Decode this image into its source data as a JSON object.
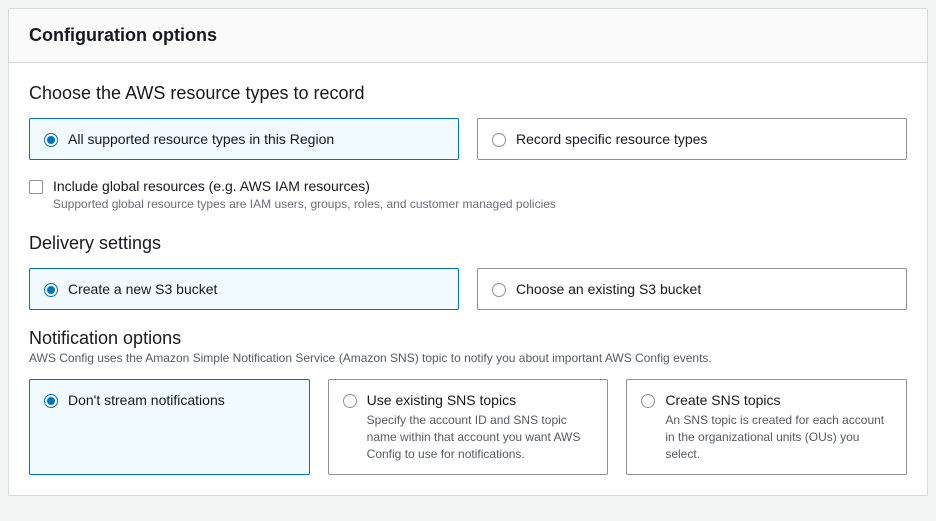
{
  "header": {
    "title": "Configuration options"
  },
  "record": {
    "title": "Choose the AWS resource types to record",
    "options": [
      {
        "label": "All supported resource types in this Region"
      },
      {
        "label": "Record specific resource types"
      }
    ],
    "checkbox": {
      "label": "Include global resources (e.g. AWS IAM resources)",
      "hint": "Supported global resource types are IAM users, groups, roles, and customer managed policies"
    }
  },
  "delivery": {
    "title": "Delivery settings",
    "options": [
      {
        "label": "Create a new S3 bucket"
      },
      {
        "label": "Choose an existing S3 bucket"
      }
    ]
  },
  "notification": {
    "title": "Notification options",
    "sub": "AWS Config uses the Amazon Simple Notification Service (Amazon SNS) topic to notify you about important AWS Config events.",
    "options": [
      {
        "label": "Don't stream notifications",
        "desc": ""
      },
      {
        "label": "Use existing SNS topics",
        "desc": "Specify the account ID and SNS topic name within that account you want AWS Config to use for notifications."
      },
      {
        "label": "Create SNS topics",
        "desc": "An SNS topic is created for each account in the organizational units (OUs) you select."
      }
    ]
  }
}
